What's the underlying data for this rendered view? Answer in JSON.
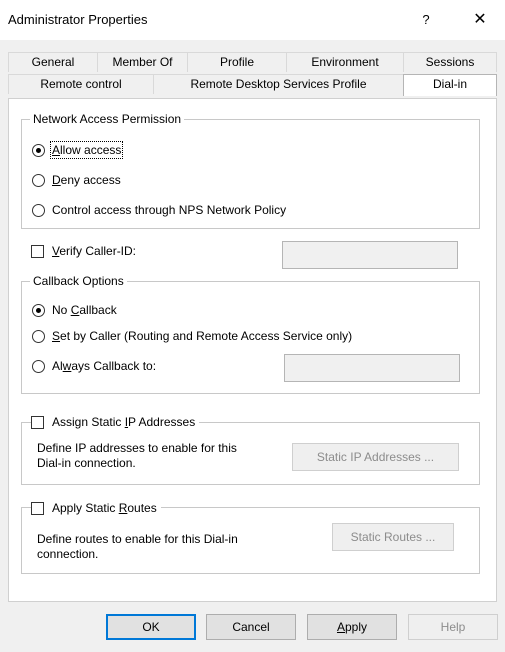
{
  "window": {
    "title": "Administrator Properties",
    "help_glyph": "?",
    "close_glyph": "✕"
  },
  "tabs_row1": [
    "General",
    "Member Of",
    "Profile",
    "Environment",
    "Sessions"
  ],
  "tabs_row2": [
    "Remote control",
    "Remote Desktop Services Profile",
    "Dial-in"
  ],
  "network_access": {
    "legend": "Network Access Permission",
    "allow": {
      "pre": "",
      "key": "A",
      "post": "llow access",
      "selected": true
    },
    "deny": {
      "pre": "",
      "key": "D",
      "post": "eny access",
      "selected": false
    },
    "nps": {
      "label": "Control access through NPS Network Policy",
      "selected": false
    }
  },
  "verify_caller": {
    "pre": "",
    "key": "V",
    "post": "erify Caller-ID:",
    "checked": false,
    "value": ""
  },
  "callback": {
    "legend": "Callback Options",
    "none": {
      "pre": "No ",
      "key": "C",
      "post": "allback",
      "selected": true
    },
    "by_caller": {
      "pre": "",
      "key": "S",
      "post": "et by Caller (Routing and Remote Access Service only)",
      "selected": false
    },
    "always": {
      "pre": "Al",
      "key": "w",
      "post": "ays Callback to:",
      "selected": false,
      "value": ""
    }
  },
  "static_ip": {
    "pre": "Assign Static ",
    "key": "I",
    "post": "P Addresses",
    "checked": false,
    "desc_line1": "Define IP addresses to enable for this",
    "desc_line2": "Dial-in connection.",
    "button": "Static IP Addresses ..."
  },
  "static_routes": {
    "pre": "Apply Static ",
    "key": "R",
    "post": "outes",
    "checked": false,
    "desc_line1": "Define routes to enable for this Dial-in",
    "desc_line2": "connection.",
    "button": "Static Routes ..."
  },
  "footer": {
    "ok": "OK",
    "cancel": "Cancel",
    "apply_key": "A",
    "apply_rest": "pply",
    "help": "Help"
  },
  "colors": {
    "accent": "#0078d7",
    "disabled_text": "#8c8c8c"
  }
}
